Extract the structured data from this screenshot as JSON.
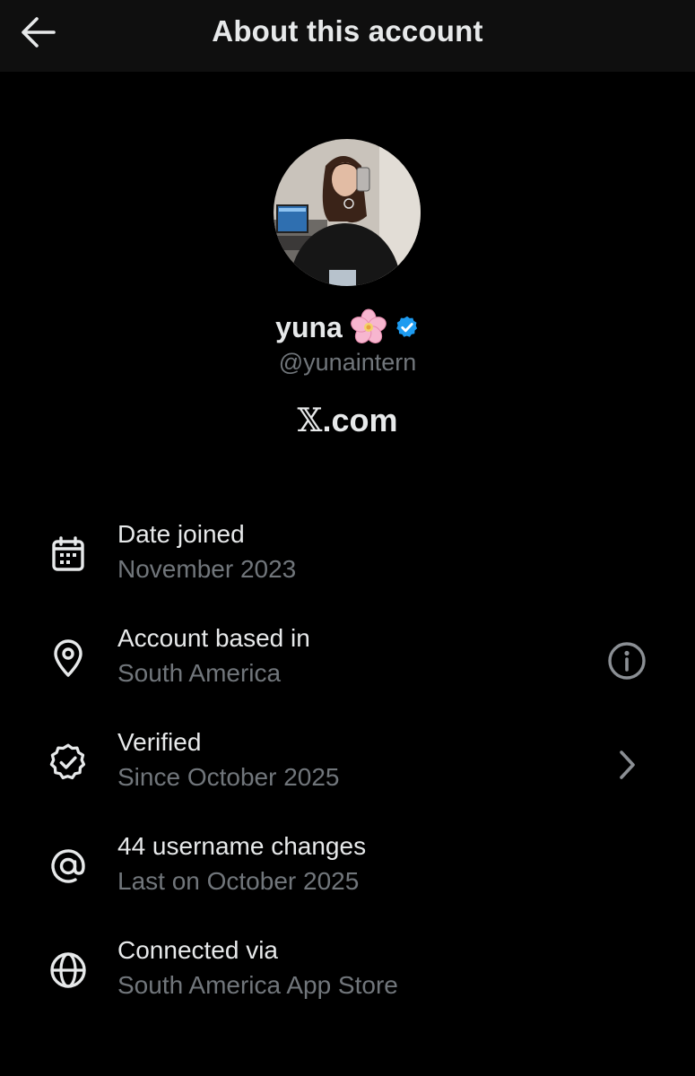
{
  "header": {
    "title": "About this account",
    "back_icon": "arrow-left-icon"
  },
  "profile": {
    "display_name": "yuna",
    "name_emoji": "cherry-blossom-icon",
    "verified_badge": "verified-badge-icon",
    "badge_color": "#1d9bf0",
    "handle": "@yunaintern",
    "site_x": "𝕏",
    "site_rest": ".com"
  },
  "details": [
    {
      "icon": "calendar-icon",
      "label": "Date joined",
      "value": "November 2023"
    },
    {
      "icon": "location-pin-icon",
      "label": "Account based in",
      "value": "South America",
      "trailing": "info-icon"
    },
    {
      "icon": "verified-check-icon",
      "label": "Verified",
      "value": "Since October 2025",
      "trailing": "chevron-right-icon"
    },
    {
      "icon": "at-sign-icon",
      "label": "44 username changes",
      "value": "Last on October 2025"
    },
    {
      "icon": "globe-icon",
      "label": "Connected via",
      "value": "South America App Store"
    }
  ],
  "colors": {
    "background": "#000000",
    "header_background": "#0f0f0f",
    "primary_text": "#e7e9ea",
    "secondary_text": "#71767b",
    "verified_blue": "#1d9bf0"
  }
}
